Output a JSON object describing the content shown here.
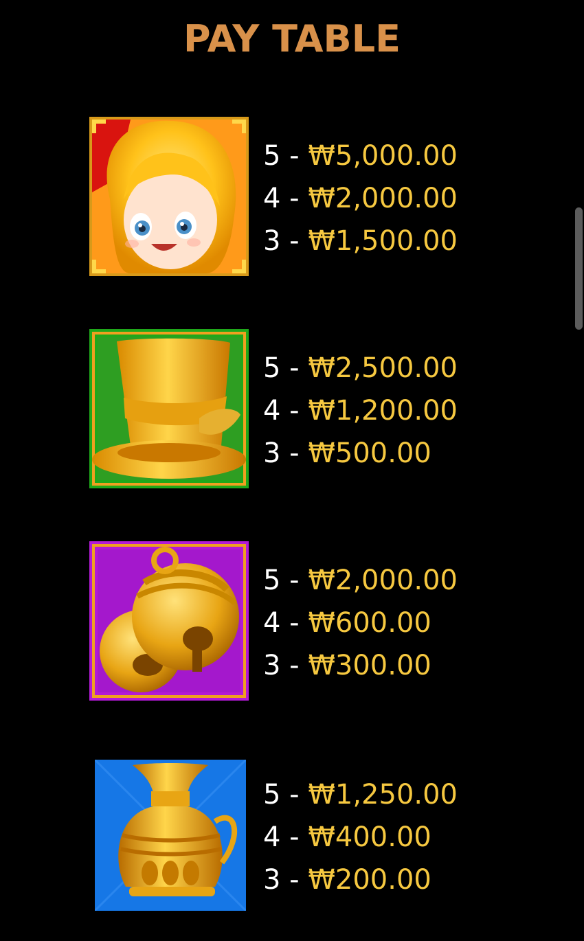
{
  "header": {
    "title": "PAY TABLE",
    "title_color": "#d9914a"
  },
  "currency_symbol": "₩",
  "colors": {
    "background": "#000000",
    "count_text": "#ffffff",
    "amount_text": "#f6c840"
  },
  "symbols": [
    {
      "name": "Alice",
      "icon": "alice-portrait-icon",
      "background": "#ff8c00",
      "pays": [
        {
          "count": "5",
          "amount": "₩5,000.00"
        },
        {
          "count": "4",
          "amount": "₩2,000.00"
        },
        {
          "count": "3",
          "amount": "₩1,500.00"
        }
      ]
    },
    {
      "name": "Top hat",
      "icon": "top-hat-icon",
      "background": "#2e9e22",
      "pays": [
        {
          "count": "5",
          "amount": "₩2,500.00"
        },
        {
          "count": "4",
          "amount": "₩1,200.00"
        },
        {
          "count": "3",
          "amount": "₩500.00"
        }
      ]
    },
    {
      "name": "Bells",
      "icon": "bells-icon",
      "background": "#b31ad6",
      "pays": [
        {
          "count": "5",
          "amount": "₩2,000.00"
        },
        {
          "count": "4",
          "amount": "₩600.00"
        },
        {
          "count": "3",
          "amount": "₩300.00"
        }
      ]
    },
    {
      "name": "Teapot vase",
      "icon": "golden-vase-icon",
      "background": "#1677e6",
      "pays": [
        {
          "count": "5",
          "amount": "₩1,250.00"
        },
        {
          "count": "4",
          "amount": "₩400.00"
        },
        {
          "count": "3",
          "amount": "₩200.00"
        }
      ]
    }
  ]
}
